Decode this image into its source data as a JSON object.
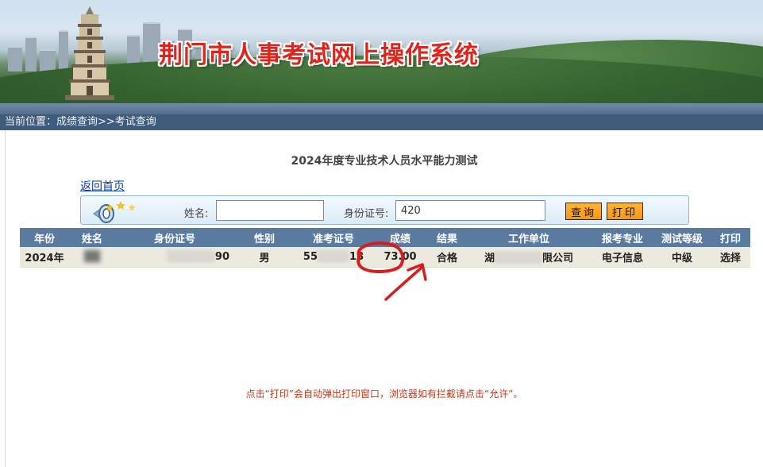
{
  "banner": {
    "title": "荆门市人事考试网上操作系统"
  },
  "breadcrumb": {
    "text": "当前位置：成绩查询>>考试查询"
  },
  "page": {
    "title": "2024年度专业技术人员水平能力测试",
    "back_link": "返回首页"
  },
  "search": {
    "name_label": "姓名:",
    "name_value": "",
    "id_label": "身份证号:",
    "id_value": "420",
    "query_label": "查询",
    "print_label": "打印"
  },
  "table": {
    "headers": [
      "年份",
      "姓名",
      "身份证号",
      "性别",
      "准考证号",
      "成绩",
      "结果",
      "工作单位",
      "报考专业",
      "测试等级",
      "打印"
    ],
    "row": {
      "year": "2024年",
      "name": "",
      "id_number": "90",
      "gender": "男",
      "exam_no_prefix": "55",
      "exam_no_suffix": "18",
      "score": "73.00",
      "result": "合格",
      "employer_prefix": "湖",
      "employer_suffix": "限公司",
      "major": "电子信息",
      "level": "中级",
      "print_action": "选择"
    }
  },
  "footer": {
    "note": "点击“打印”会自动弹出打印窗口，浏览器如有拦截请点击“允许”。"
  },
  "colors": {
    "header_bg": "#5a7aa0",
    "breadcrumb_bg": "#3f5c7c",
    "title_red": "#e0241b",
    "annotation_red": "#d71e1e",
    "button_orange": "#ff9f1a",
    "note_red": "#c0391b",
    "row_bg": "#ece9df"
  },
  "icons": {
    "search_panel_icon": "speaker-icon",
    "annotation": "hand-drawn-circle-and-arrow"
  }
}
